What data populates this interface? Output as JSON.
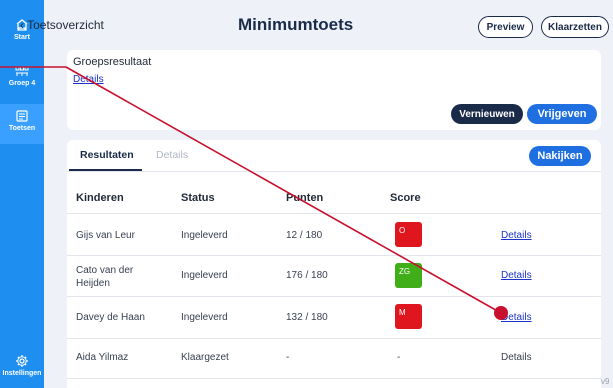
{
  "sidebar": {
    "items": [
      {
        "label": "Start",
        "icon": "home-icon"
      },
      {
        "label": "Groep 4",
        "icon": "group-icon"
      },
      {
        "label": "Toetsen",
        "icon": "test-icon"
      },
      {
        "label": "Instellingen",
        "icon": "gear-icon"
      }
    ]
  },
  "header": {
    "back_label": "Toetsoverzicht",
    "title": "Minimumtoets",
    "preview_label": "Preview",
    "ready_label": "Klaarzetten"
  },
  "group_card": {
    "title": "Groepsresultaat",
    "details_link": "Details",
    "refresh_label": "Vernieuwen",
    "release_label": "Vrijgeven"
  },
  "results": {
    "tabs": [
      "Resultaten",
      "Details"
    ],
    "grade_label": "Nakijken",
    "columns": [
      "Kinderen",
      "Status",
      "Punten",
      "Score"
    ],
    "rows": [
      {
        "name": "Gijs van Leur",
        "status": "Ingeleverd",
        "points": "12 / 180",
        "score": "O",
        "score_color": "#e0161f",
        "details": "Details",
        "linked": true
      },
      {
        "name": "Cato van der Heijden",
        "status": "Ingeleverd",
        "points": "176 / 180",
        "score": "ZG",
        "score_color": "#3fae18",
        "details": "Details",
        "linked": true
      },
      {
        "name": "Davey de Haan",
        "status": "Ingeleverd",
        "points": "132 / 180",
        "score": "M",
        "score_color": "#e0161f",
        "details": "Details",
        "linked": true
      },
      {
        "name": "Aida Yilmaz",
        "status": "Klaargezet",
        "points": "-",
        "score": "-",
        "score_color": "",
        "details": "Details",
        "linked": false
      }
    ]
  },
  "version": "v9",
  "colors": {
    "sidebar": "#1f8ef1",
    "navy": "#1a2b49",
    "primary": "#1f6fe0",
    "annotation": "#c8102e"
  }
}
